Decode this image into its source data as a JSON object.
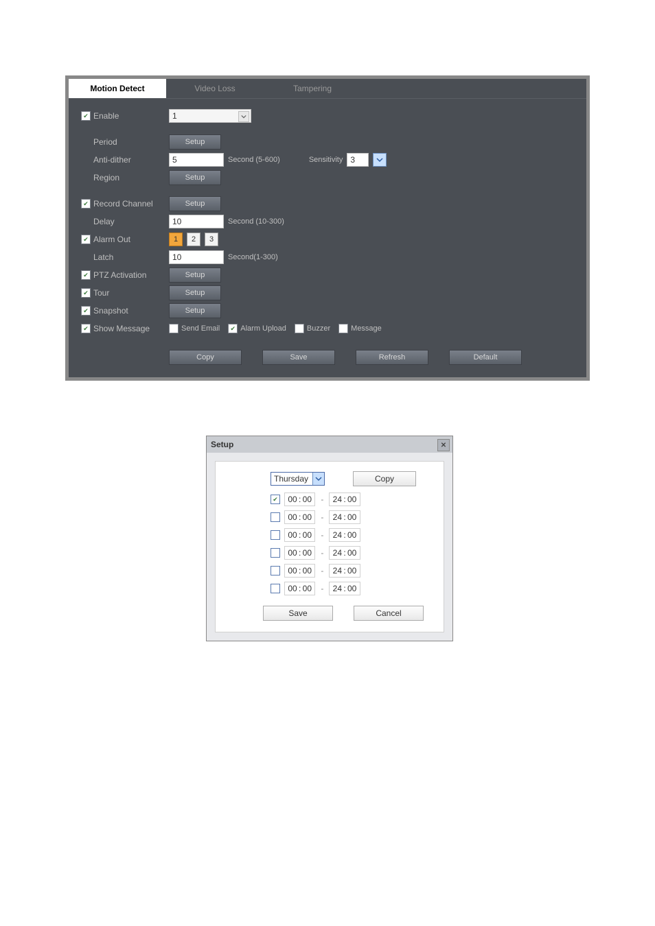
{
  "tabs": {
    "motion_detect": "Motion Detect",
    "video_loss": "Video Loss",
    "tampering": "Tampering"
  },
  "main": {
    "enable": {
      "checked": true,
      "label": "Enable",
      "channel": "1"
    },
    "period": {
      "label": "Period",
      "setup": "Setup"
    },
    "anti_dither": {
      "label": "Anti-dither",
      "value": "5",
      "unit": "Second (5-600)",
      "sens_label": "Sensitivity",
      "sens_value": "3"
    },
    "region": {
      "label": "Region",
      "setup": "Setup"
    },
    "record_channel": {
      "checked": true,
      "label": "Record Channel",
      "setup": "Setup"
    },
    "delay": {
      "label": "Delay",
      "value": "10",
      "unit": "Second (10-300)"
    },
    "alarm_out": {
      "checked": true,
      "label": "Alarm Out",
      "options": [
        "1",
        "2",
        "3"
      ],
      "selected": 0
    },
    "latch": {
      "label": "Latch",
      "value": "10",
      "unit": "Second(1-300)"
    },
    "ptz": {
      "checked": true,
      "label": "PTZ Activation",
      "setup": "Setup"
    },
    "tour": {
      "checked": true,
      "label": "Tour",
      "setup": "Setup"
    },
    "snapshot": {
      "checked": true,
      "label": "Snapshot",
      "setup": "Setup"
    },
    "show_message": {
      "checked": true,
      "label": "Show Message",
      "send_email": {
        "checked": false,
        "label": "Send Email"
      },
      "alarm_upload": {
        "checked": true,
        "label": "Alarm Upload"
      },
      "buzzer": {
        "checked": false,
        "label": "Buzzer"
      },
      "message": {
        "checked": false,
        "label": "Message"
      }
    },
    "buttons": {
      "copy": "Copy",
      "save": "Save",
      "refresh": "Refresh",
      "default": "Default"
    }
  },
  "dialog": {
    "title": "Setup",
    "day": "Thursday",
    "copy": "Copy",
    "rows": [
      {
        "checked": true,
        "from_h": "00",
        "from_m": "00",
        "to_h": "24",
        "to_m": "00"
      },
      {
        "checked": false,
        "from_h": "00",
        "from_m": "00",
        "to_h": "24",
        "to_m": "00"
      },
      {
        "checked": false,
        "from_h": "00",
        "from_m": "00",
        "to_h": "24",
        "to_m": "00"
      },
      {
        "checked": false,
        "from_h": "00",
        "from_m": "00",
        "to_h": "24",
        "to_m": "00"
      },
      {
        "checked": false,
        "from_h": "00",
        "from_m": "00",
        "to_h": "24",
        "to_m": "00"
      },
      {
        "checked": false,
        "from_h": "00",
        "from_m": "00",
        "to_h": "24",
        "to_m": "00"
      }
    ],
    "save": "Save",
    "cancel": "Cancel"
  }
}
